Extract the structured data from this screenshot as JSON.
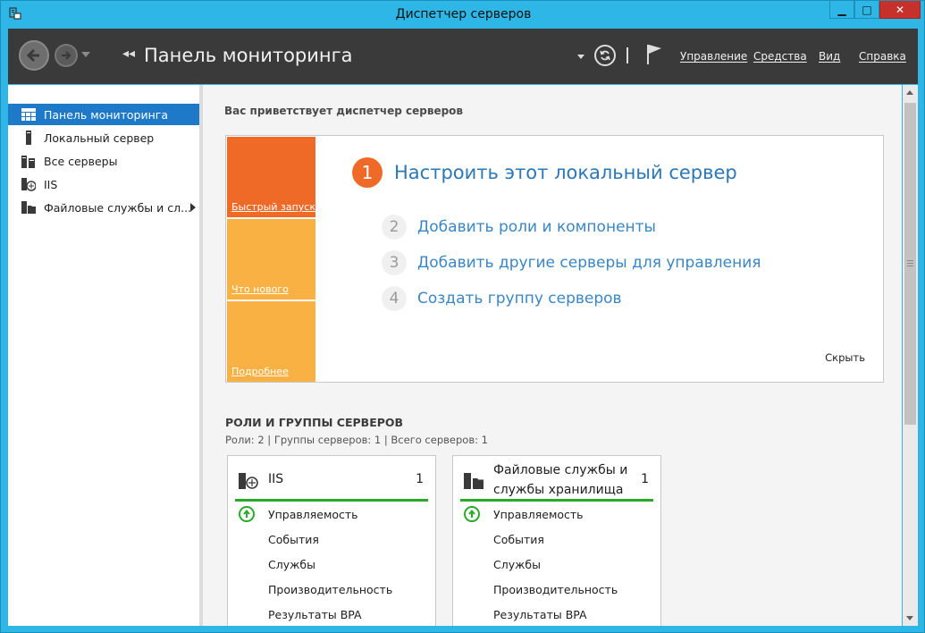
{
  "window": {
    "title": "Диспетчер серверов",
    "minimize_glyph": "▁",
    "maximize_glyph": "□",
    "close_glyph": "✕"
  },
  "header": {
    "breadcrumb_glyph": "◂◂",
    "title": "Панель мониторинга",
    "menu": {
      "manage": "Управление",
      "tools": "Средства",
      "view": "Вид",
      "help": "Справка"
    }
  },
  "sidebar": {
    "items": [
      {
        "label": "Панель мониторинга",
        "icon": "dashboard-icon",
        "active": true
      },
      {
        "label": "Локальный сервер",
        "icon": "local-server-icon"
      },
      {
        "label": "Все серверы",
        "icon": "all-servers-icon"
      },
      {
        "label": "IIS",
        "icon": "iis-icon"
      },
      {
        "label": "Файловые службы и сл...",
        "icon": "file-services-icon"
      }
    ]
  },
  "welcome": "Вас приветствует диспетчер серверов",
  "quickstart": {
    "tiles": [
      "Быстрый запуск",
      "Что нового",
      "Подробнее"
    ],
    "steps": [
      {
        "num": "1",
        "text": "Настроить этот локальный сервер"
      },
      {
        "num": "2",
        "text": "Добавить роли и компоненты"
      },
      {
        "num": "3",
        "text": "Добавить другие серверы для управления"
      },
      {
        "num": "4",
        "text": "Создать группу серверов"
      }
    ],
    "hide": "Скрыть"
  },
  "roles": {
    "title": "РОЛИ И ГРУППЫ СЕРВЕРОВ",
    "subtitle": "Роли: 2 | Группы серверов: 1 | Всего серверов: 1",
    "cards": [
      {
        "name_line1": "IIS",
        "name_line2": "",
        "count": "1",
        "rows": [
          "Управляемость",
          "События",
          "Службы",
          "Производительность",
          "Результаты BPA"
        ]
      },
      {
        "name_line1": "Файловые службы и",
        "name_line2": "службы хранилища",
        "count": "1",
        "rows": [
          "Управляемость",
          "События",
          "Службы",
          "Производительность",
          "Результаты BPA"
        ]
      }
    ]
  },
  "colors": {
    "accent_orange": "#f06a27",
    "tile_yellow": "#fab143",
    "link_blue": "#3a86c4",
    "selection_blue": "#1e7ac8",
    "status_green": "#2aaa2a",
    "frame_cyan": "#2eb7e6"
  }
}
